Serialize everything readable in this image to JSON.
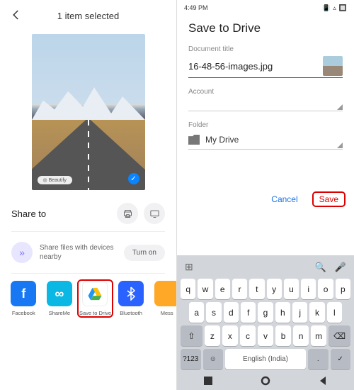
{
  "screen1": {
    "title": "1 item selected",
    "beautify": "Beautify",
    "share_label": "Share to",
    "nearby_text": "Share files with devices nearby",
    "turn_on": "Turn on",
    "apps": [
      {
        "label": "Facebook"
      },
      {
        "label": "ShareMe"
      },
      {
        "label": "Save to Drive"
      },
      {
        "label": "Bluetooth"
      },
      {
        "label": "Mess"
      }
    ]
  },
  "screen2": {
    "time": "4:49 PM",
    "heading": "Save to Drive",
    "doc_title_label": "Document title",
    "doc_title_value": "16-48-56-images.jpg",
    "account_label": "Account",
    "folder_label": "Folder",
    "folder_value": "My Drive",
    "cancel": "Cancel",
    "save": "Save",
    "kb_row1": [
      "q",
      "w",
      "e",
      "r",
      "t",
      "y",
      "u",
      "i",
      "o",
      "p"
    ],
    "kb_row2": [
      "a",
      "s",
      "d",
      "f",
      "g",
      "h",
      "j",
      "k",
      "l"
    ],
    "kb_row3": [
      "z",
      "x",
      "c",
      "v",
      "b",
      "n",
      "m"
    ],
    "kb_mode": "?123",
    "kb_lang": "English (India)"
  }
}
